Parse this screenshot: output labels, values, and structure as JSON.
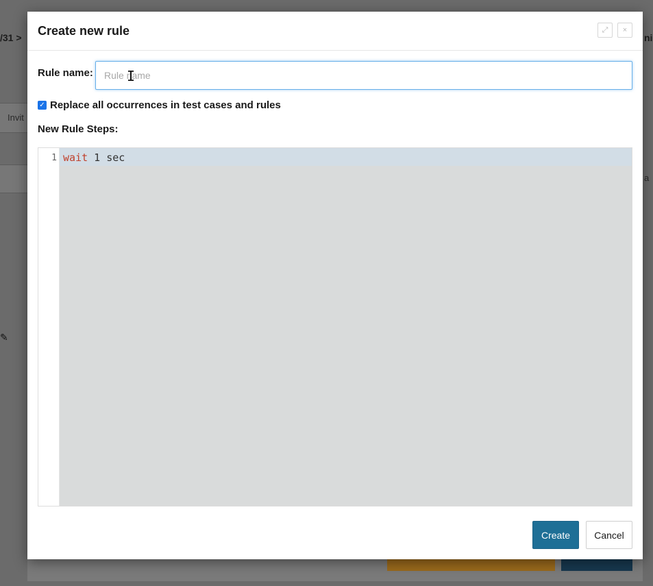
{
  "background": {
    "breadcrumb_fragment": "/31 >",
    "rail_tab_fragment": "Invit",
    "right_fragment": "ni",
    "right_fragment2": "a",
    "edit_icon": "edit-icon"
  },
  "modal": {
    "title": "Create new rule",
    "header_buttons": {
      "expand_icon": "expand-icon",
      "expand_glyph": "⤢",
      "close_icon": "close-icon",
      "close_glyph": "×"
    },
    "rule_name": {
      "label": "Rule name:",
      "value": "",
      "placeholder": "Rule name"
    },
    "replace_option": {
      "checked": true,
      "label": "Replace all occurrences in test cases and rules"
    },
    "steps": {
      "label": "New Rule Steps:",
      "lines": [
        {
          "number": "1",
          "keyword": "wait",
          "rest": " 1 sec"
        }
      ]
    },
    "buttons": {
      "create": "Create",
      "cancel": "Cancel"
    }
  },
  "colors": {
    "primary_button": "#1e6f96",
    "input_focus": "#66afe9",
    "keyword": "#c0412d",
    "editor_bg": "#d9dbdb",
    "checkbox": "#1a73e8"
  }
}
